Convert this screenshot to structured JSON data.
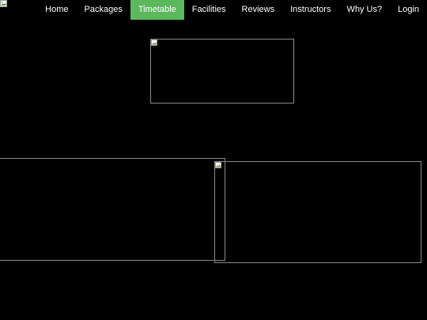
{
  "header": {
    "logo_icon": "broken-image-icon",
    "nav": [
      {
        "label": "Home",
        "active": false
      },
      {
        "label": "Packages",
        "active": false
      },
      {
        "label": "Timetable",
        "active": true
      },
      {
        "label": "Facilities",
        "active": false
      },
      {
        "label": "Reviews",
        "active": false
      },
      {
        "label": "Instructors",
        "active": false
      },
      {
        "label": "Why Us?",
        "active": false
      },
      {
        "label": "Login",
        "active": false
      }
    ],
    "active_color": "#5cb85c"
  },
  "images": [
    {
      "name": "hero-image",
      "icon": "broken-image-icon"
    },
    {
      "name": "feature-image-left",
      "icon": "broken-image-icon"
    },
    {
      "name": "feature-image-right",
      "icon": "broken-image-icon"
    }
  ]
}
